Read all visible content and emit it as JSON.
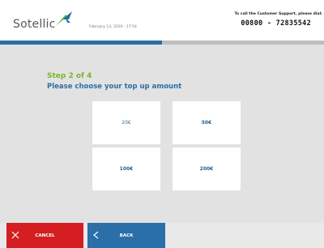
{
  "header": {
    "brand": "Sotellic",
    "datetime": "February 13, 2016 - 17:54",
    "support_label": "To call the Customer Support, please dial:",
    "support_phone": "00800 - 72835542"
  },
  "progress": {
    "step": 2,
    "total": 4,
    "fraction": 0.5
  },
  "content": {
    "step_label": "Step 2 of 4",
    "instruction": "Please choose your top up amount",
    "amounts": [
      "20€",
      "50€",
      "100€",
      "200€"
    ]
  },
  "footer": {
    "cancel_label": "CANCEL",
    "back_label": "BACK"
  },
  "colors": {
    "accent_blue": "#2a6fa8",
    "step_green": "#76b82a",
    "cancel_red": "#d41e21"
  }
}
